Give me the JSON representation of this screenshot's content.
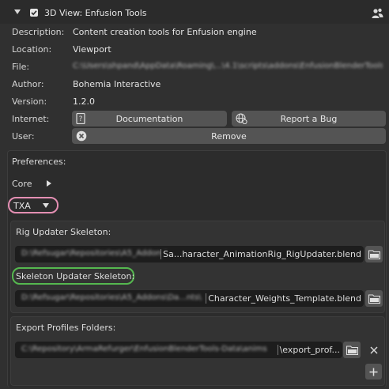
{
  "header": {
    "title": "3D View: Enfusion Tools",
    "enabled": true,
    "user_icon": "users-icon"
  },
  "info": {
    "description_label": "Description:",
    "description_value": "Content creation tools for Enfusion engine",
    "location_label": "Location:",
    "location_value": "Viewport",
    "file_label": "File:",
    "file_value": "C:\\Users\\shpand\\AppData\\Roaming\\...\\4.1\\scripts\\addons\\EnfusionBlenderTools\\__init__.py",
    "author_label": "Author:",
    "author_value": "Bohemia Interactive",
    "version_label": "Version:",
    "version_value": "1.2.0",
    "internet_label": "Internet:",
    "documentation_button": "Documentation",
    "report_bug_button": "Report a Bug",
    "user_label": "User:",
    "remove_button": "Remove"
  },
  "preferences": {
    "title": "Preferences:",
    "core_label": "Core",
    "txa_label": "TXA",
    "rig_updater": {
      "label": "Rig Updater Skeleton:",
      "path_hidden": "D:\\Refsugar\\Repositories\\A5_Addons\\",
      "path_visible": "Sa...haracter_AnimationRig_RigUpdater.blend"
    },
    "skeleton_updater": {
      "label": "Skeleton Updater Skeleton:",
      "path_hidden": "D:\\Refsugar\\Repositories\\A5_Addons\\Da...nts\\",
      "path_visible": "Character_Weights_Template.blend"
    },
    "export_profiles": {
      "label": "Export Profiles Folders:",
      "path_hidden": "C:\\Repository\\ArmaRefurger\\EnfusionBlenderTools-Data\\anims",
      "path_visible": "\\export_prof..."
    }
  },
  "colors": {
    "txa_highlight": "#e48fb3",
    "skeleton_highlight": "#55b84f"
  }
}
